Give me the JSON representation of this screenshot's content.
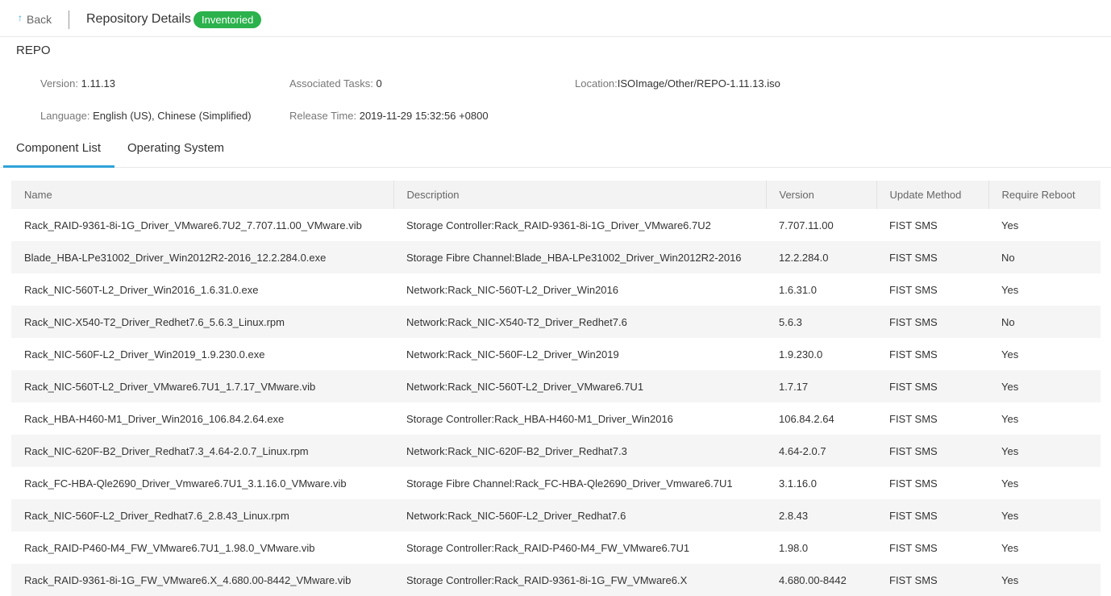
{
  "header": {
    "back_label": "Back",
    "back_icon": "↑",
    "title": "Repository Details",
    "status_badge": "Inventoried",
    "badge_color": "#2bb24c",
    "accent_color": "#2fa3d9"
  },
  "repo": {
    "name": "REPO",
    "version_label": "Version:",
    "version": "1.11.13",
    "tasks_label": "Associated Tasks:",
    "tasks": "0",
    "location_label": "Location:",
    "location": "ISOImage/Other/REPO-1.11.13.iso",
    "language_label": "Language:",
    "language": "English (US), Chinese (Simplified)",
    "release_label": "Release Time:",
    "release": "2019-11-29 15:32:56 +0800"
  },
  "tabs": [
    {
      "label": "Component List",
      "active": true
    },
    {
      "label": "Operating System",
      "active": false
    }
  ],
  "table": {
    "columns": [
      "Name",
      "Description",
      "Version",
      "Update Method",
      "Require Reboot"
    ],
    "rows": [
      [
        "Rack_RAID-9361-8i-1G_Driver_VMware6.7U2_7.707.11.00_VMware.vib",
        "Storage Controller:Rack_RAID-9361-8i-1G_Driver_VMware6.7U2",
        "7.707.11.00",
        "FIST SMS",
        "Yes"
      ],
      [
        "Blade_HBA-LPe31002_Driver_Win2012R2-2016_12.2.284.0.exe",
        "Storage Fibre Channel:Blade_HBA-LPe31002_Driver_Win2012R2-2016",
        "12.2.284.0",
        "FIST SMS",
        "No"
      ],
      [
        "Rack_NIC-560T-L2_Driver_Win2016_1.6.31.0.exe",
        "Network:Rack_NIC-560T-L2_Driver_Win2016",
        "1.6.31.0",
        "FIST SMS",
        "Yes"
      ],
      [
        "Rack_NIC-X540-T2_Driver_Redhet7.6_5.6.3_Linux.rpm",
        "Network:Rack_NIC-X540-T2_Driver_Redhet7.6",
        "5.6.3",
        "FIST SMS",
        "No"
      ],
      [
        "Rack_NIC-560F-L2_Driver_Win2019_1.9.230.0.exe",
        "Network:Rack_NIC-560F-L2_Driver_Win2019",
        "1.9.230.0",
        "FIST SMS",
        "Yes"
      ],
      [
        "Rack_NIC-560T-L2_Driver_VMware6.7U1_1.7.17_VMware.vib",
        "Network:Rack_NIC-560T-L2_Driver_VMware6.7U1",
        "1.7.17",
        "FIST SMS",
        "Yes"
      ],
      [
        "Rack_HBA-H460-M1_Driver_Win2016_106.84.2.64.exe",
        "Storage Controller:Rack_HBA-H460-M1_Driver_Win2016",
        "106.84.2.64",
        "FIST SMS",
        "Yes"
      ],
      [
        "Rack_NIC-620F-B2_Driver_Redhat7.3_4.64-2.0.7_Linux.rpm",
        "Network:Rack_NIC-620F-B2_Driver_Redhat7.3",
        "4.64-2.0.7",
        "FIST SMS",
        "Yes"
      ],
      [
        "Rack_FC-HBA-Qle2690_Driver_Vmware6.7U1_3.1.16.0_VMware.vib",
        "Storage Fibre Channel:Rack_FC-HBA-Qle2690_Driver_Vmware6.7U1",
        "3.1.16.0",
        "FIST SMS",
        "Yes"
      ],
      [
        "Rack_NIC-560F-L2_Driver_Redhat7.6_2.8.43_Linux.rpm",
        "Network:Rack_NIC-560F-L2_Driver_Redhat7.6",
        "2.8.43",
        "FIST SMS",
        "Yes"
      ],
      [
        "Rack_RAID-P460-M4_FW_VMware6.7U1_1.98.0_VMware.vib",
        "Storage Controller:Rack_RAID-P460-M4_FW_VMware6.7U1",
        "1.98.0",
        "FIST SMS",
        "Yes"
      ],
      [
        "Rack_RAID-9361-8i-1G_FW_VMware6.X_4.680.00-8442_VMware.vib",
        "Storage Controller:Rack_RAID-9361-8i-1G_FW_VMware6.X",
        "4.680.00-8442",
        "FIST SMS",
        "Yes"
      ]
    ]
  }
}
